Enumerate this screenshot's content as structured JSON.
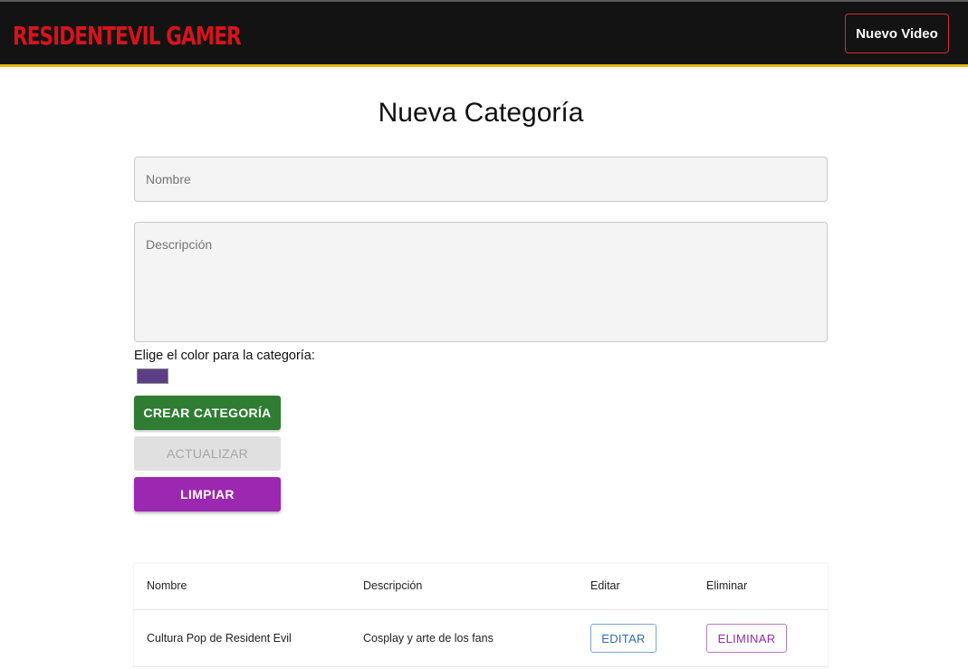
{
  "header": {
    "logo_text": "RESIDENTEVIL GAMER",
    "nuevo_video_label": "Nuevo Video"
  },
  "form": {
    "title": "Nueva Categoría",
    "nombre_placeholder": "Nombre",
    "nombre_value": "",
    "descripcion_placeholder": "Descripción",
    "descripcion_value": "",
    "color_label": "Elige el color para la categoría:",
    "selected_color": "#5b3f86",
    "buttons": {
      "crear": "CREAR CATEGORÍA",
      "actualizar": "ACTUALIZAR",
      "limpiar": "LIMPIAR"
    }
  },
  "table": {
    "headers": [
      "Nombre",
      "Descripción",
      "Editar",
      "Eliminar"
    ],
    "rows": [
      {
        "nombre": "Cultura Pop de Resident Evil",
        "descripcion": "Cosplay y arte de los fans",
        "editar_label": "EDITAR",
        "eliminar_label": "ELIMINAR"
      }
    ]
  },
  "colors": {
    "header_bg": "#131313",
    "header_accent": "#e8b50a",
    "logo_red": "#d6141b",
    "crear_green": "#2e7d32",
    "limpiar_purple": "#9c27b0",
    "editar_blue": "#2f6ea8",
    "eliminar_purple": "#8e2ea3"
  }
}
